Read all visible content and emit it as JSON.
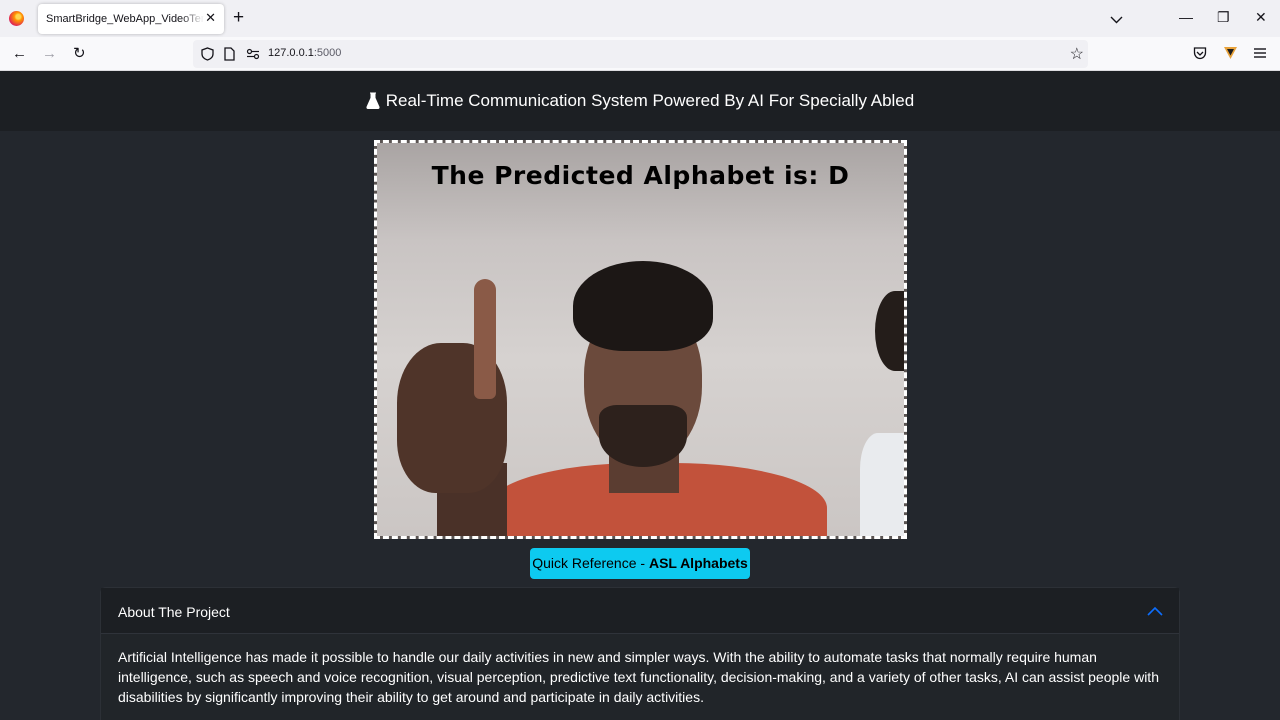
{
  "browser": {
    "tab_title": "SmartBridge_WebApp_VideoTemplate",
    "tab_close": "✕",
    "new_tab": "+",
    "url_host": "127.0.0.1",
    "url_port": ":5000",
    "minimize": "—",
    "restore": "❐",
    "close": "✕",
    "back": "←",
    "forward": "→",
    "reload": "↻",
    "bookmark_star": "☆"
  },
  "page": {
    "title": "Real-Time Communication System Powered By AI For Specially Abled",
    "title_icon": "flask-icon",
    "video": {
      "prediction_text": "The Predicted Alphabet is: D"
    },
    "reference_button": {
      "prefix": "Quick Reference - ",
      "bold": "ASL Alphabets"
    },
    "accordion": {
      "title": "About The Project",
      "expanded": true,
      "body": "Artificial Intelligence has made it possible to handle our daily activities in new and simpler ways. With the ability to automate tasks that normally require human intelligence, such as speech and voice recognition, visual perception, predictive text functionality, decision-making, and a variety of other tasks, AI can assist people with disabilities by significantly improving their ability to get around and participate in daily activities."
    }
  },
  "colors": {
    "page_bg": "#23272d",
    "header_bg": "#1c1f23",
    "button_info": "#0dcaf0",
    "accent_blue": "#0d6efd"
  }
}
